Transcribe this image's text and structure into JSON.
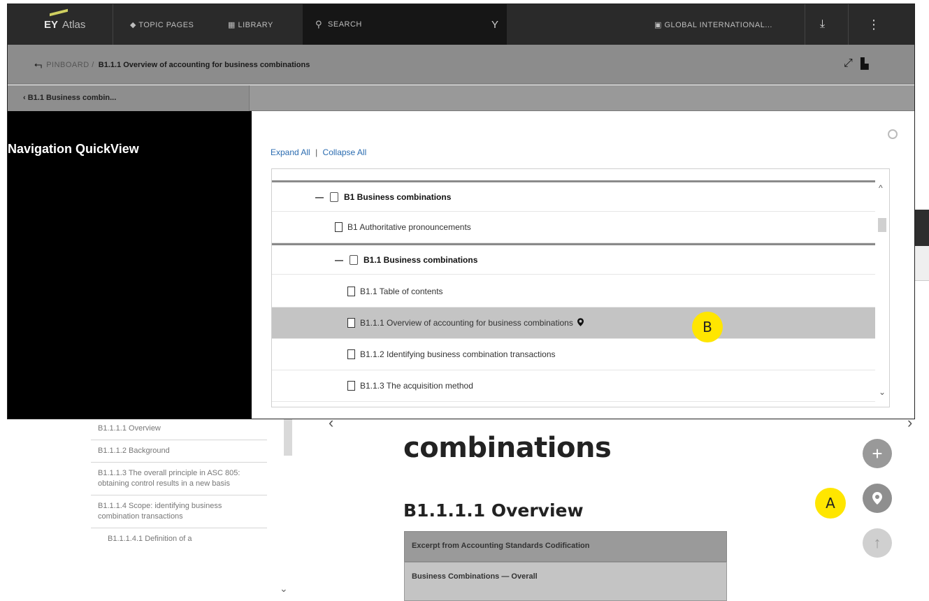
{
  "header": {
    "logo": "EY",
    "logo_sub": "Atlas",
    "topic_pages": "◆ TOPIC PAGES",
    "library": "▦ LIBRARY",
    "search": "SEARCH",
    "region": "▣ GLOBAL INTERNATIONAL..."
  },
  "breadcrumb": {
    "back": "⮢",
    "pinboard": "PINBOARD /",
    "current": "B1.1.1 Overview of accounting for business combinations"
  },
  "subnav": {
    "parent": "‹ B1.1 Business combin..."
  },
  "quickview": {
    "title": "Navigation QuickView",
    "expand_all": "Expand All",
    "separator": "|",
    "collapse_all": "Collapse All",
    "rows": [
      {
        "label": "B1 Business combinations",
        "type": "folder"
      },
      {
        "label": "B1 Authoritative pronouncements",
        "type": "doc"
      },
      {
        "label": "B1.1 Business combinations",
        "type": "folder"
      },
      {
        "label": "B1.1 Table of contents",
        "type": "doc"
      },
      {
        "label": "B1.1.1 Overview of accounting for business combinations",
        "type": "doc",
        "selected": true
      },
      {
        "label": "B1.1.2 Identifying business combination transactions",
        "type": "doc"
      },
      {
        "label": "B1.1.3 The acquisition method",
        "type": "doc"
      }
    ]
  },
  "toc": {
    "items": [
      "B1.1.1.1 Overview",
      "B1.1.1.2 Background",
      "B1.1.1.3 The overall principle in ASC 805: obtaining control results in a new basis",
      "B1.1.1.4 Scope: identifying business combination transactions",
      "B1.1.1.4.1 Definition of a"
    ]
  },
  "document": {
    "title": "combinations",
    "heading": "B1.1.1.1 Overview",
    "excerpt_header": "Excerpt from Accounting Standards Codification",
    "excerpt_row": "Business Combinations — Overall"
  },
  "annotations": {
    "a": "A",
    "b": "B"
  },
  "colors": {
    "callout": "#ffe600",
    "selected_row": "#c4c4c4",
    "link": "#2b6cb0"
  }
}
